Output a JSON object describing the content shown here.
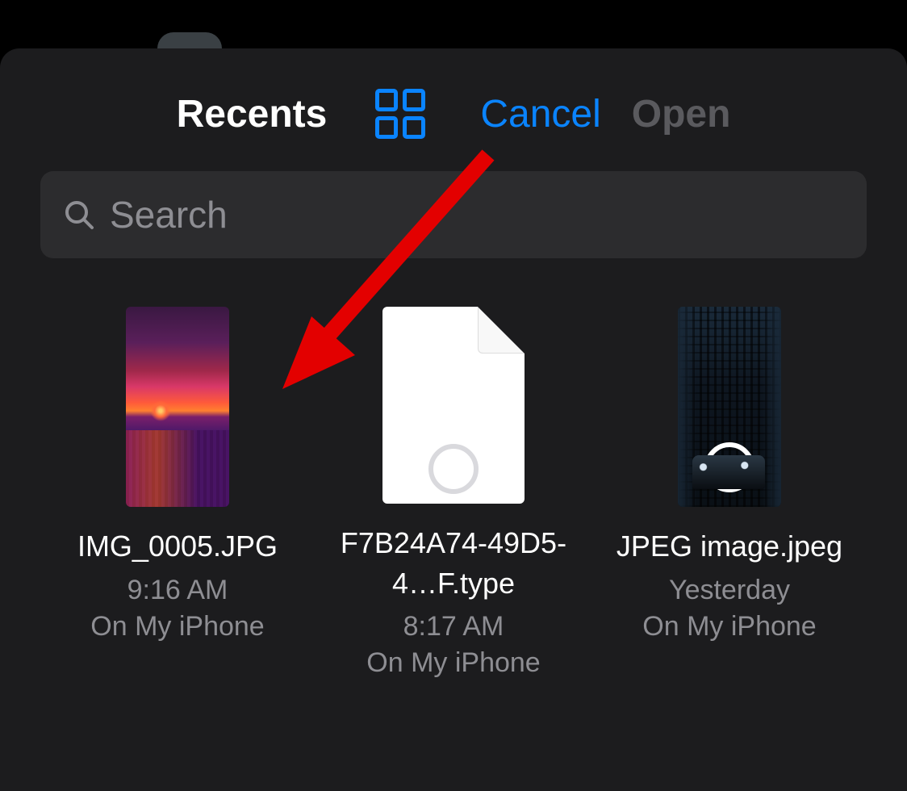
{
  "header": {
    "title": "Recents",
    "cancel_label": "Cancel",
    "open_label": "Open"
  },
  "search": {
    "placeholder": "Search",
    "value": ""
  },
  "items": [
    {
      "name": "IMG_0005.JPG",
      "time": "9:16 AM",
      "location": "On My iPhone",
      "thumb_kind": "sunset"
    },
    {
      "name": "F7B24A74-49D5-4…F.type",
      "time": "8:17 AM",
      "location": "On My iPhone",
      "thumb_kind": "doc"
    },
    {
      "name": "JPEG image.jpeg",
      "time": "Yesterday",
      "location": "On My iPhone",
      "thumb_kind": "city"
    }
  ]
}
